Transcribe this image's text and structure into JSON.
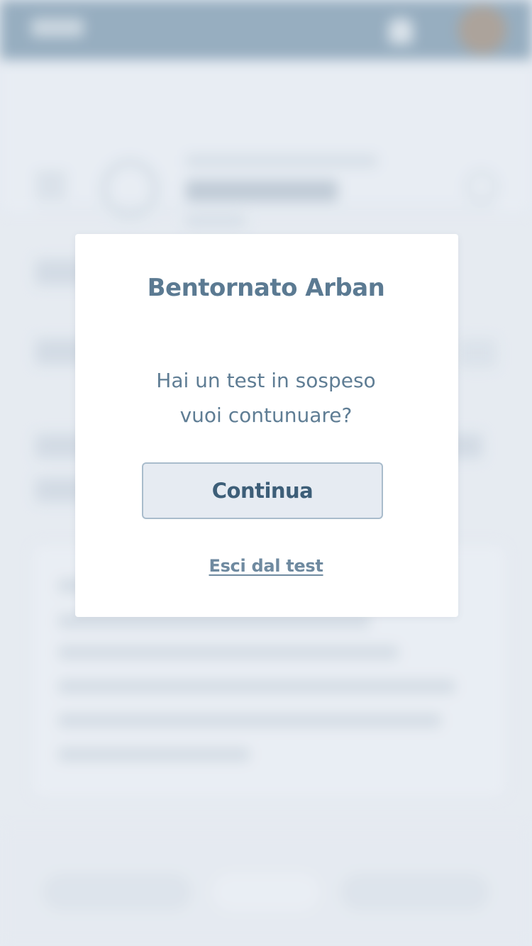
{
  "colors": {
    "topbar": "#6a8aa3",
    "page_bg": "#e3e8ef",
    "title_text": "#5b7a92",
    "button_border": "#a9bccc",
    "button_text": "#3d5e78"
  },
  "topbar": {
    "icons": [
      "app-logo",
      "bell-icon",
      "avatar"
    ]
  },
  "header": {
    "icons": [
      "menu-icon",
      "shield-icon",
      "search-icon"
    ]
  },
  "modal": {
    "title": "Bentornato Arban",
    "message_line1": "Hai un test in sospeso",
    "message_line2": "vuoi contunuare?",
    "continue_label": "Continua",
    "exit_label": "Esci dal test"
  }
}
